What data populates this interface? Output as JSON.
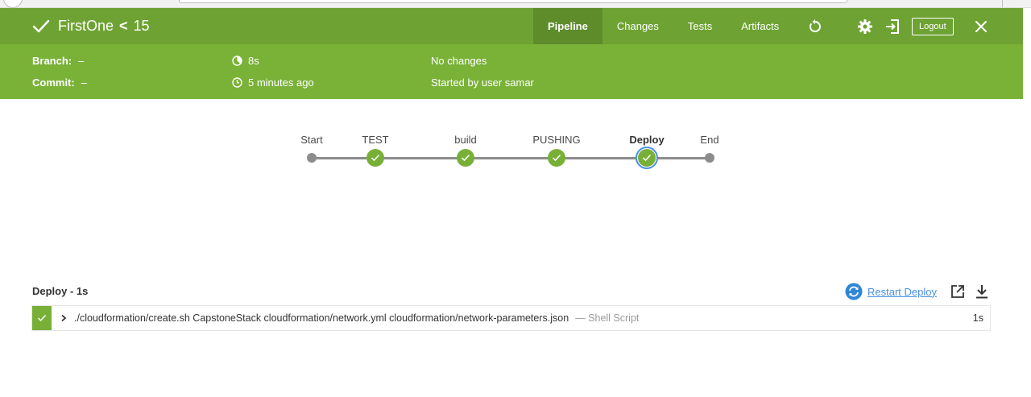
{
  "header": {
    "job_name": "FirstOne",
    "run_separator": "<",
    "run_number": "15",
    "tabs": [
      {
        "label": "Pipeline",
        "active": true
      },
      {
        "label": "Changes",
        "active": false
      },
      {
        "label": "Tests",
        "active": false
      },
      {
        "label": "Artifacts",
        "active": false
      }
    ],
    "icons": [
      "replay-icon",
      "gear-icon",
      "exit-icon",
      "close-icon"
    ],
    "logout_label": "Logout"
  },
  "meta": {
    "branch_label": "Branch:",
    "branch_value": "–",
    "commit_label": "Commit:",
    "commit_value": "–",
    "duration": "8s",
    "started_ago": "5 minutes ago",
    "changes": "No changes",
    "started_by": "Started by user samar"
  },
  "pipeline": {
    "stages": [
      {
        "label": "Start",
        "status": "start"
      },
      {
        "label": "TEST",
        "status": "success"
      },
      {
        "label": "build",
        "status": "success"
      },
      {
        "label": "PUSHING",
        "status": "success"
      },
      {
        "label": "Deploy",
        "status": "success",
        "selected": true
      },
      {
        "label": "End",
        "status": "end"
      }
    ]
  },
  "step_panel": {
    "title": "Deploy - 1s",
    "restart_label": "Restart Deploy",
    "icons": [
      "restart-icon",
      "open-external-icon",
      "download-icon"
    ],
    "steps": [
      {
        "command": "./cloudformation/create.sh CapstoneStack cloudformation/network.yml cloudformation/network-parameters.json",
        "kind": "— Shell Script",
        "duration": "1s",
        "status": "success"
      }
    ]
  },
  "colors": {
    "header_green": "#6ea333",
    "meta_green": "#7ab238",
    "success_green": "#78b037",
    "select_blue": "#4a90e2",
    "track_gray": "#8c8c8c"
  }
}
